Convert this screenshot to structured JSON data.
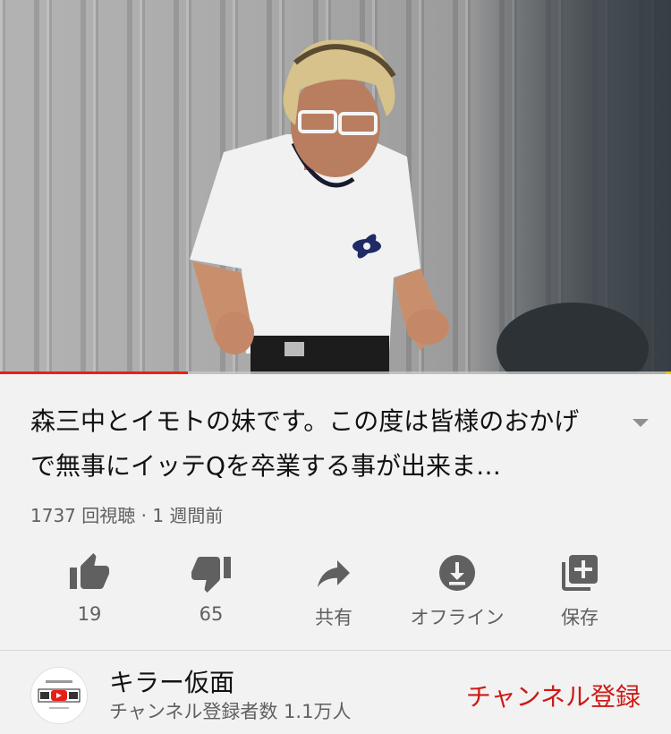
{
  "player": {
    "progress_fraction": 0.28,
    "colors": {
      "played": "#e62117",
      "buffered": "#c8c8c8",
      "marker": "#f3c200"
    }
  },
  "video": {
    "title": "森三中とイモトの妹です。この度は皆様のおかげで無事にイッテQを卒業する事が出来ま…",
    "meta": "1737 回視聴 · 1 週間前"
  },
  "actions": [
    {
      "icon": "thumb-up-icon",
      "label": "19"
    },
    {
      "icon": "thumb-down-icon",
      "label": "65"
    },
    {
      "icon": "share-icon",
      "label": "共有"
    },
    {
      "icon": "download-icon",
      "label": "オフライン"
    },
    {
      "icon": "playlist-add-icon",
      "label": "保存"
    }
  ],
  "channel": {
    "name": "キラー仮面",
    "subscribers": "チャンネル登録者数 1.1万人",
    "subscribe_label": "チャンネル登録",
    "accent": "#cc1a16"
  }
}
